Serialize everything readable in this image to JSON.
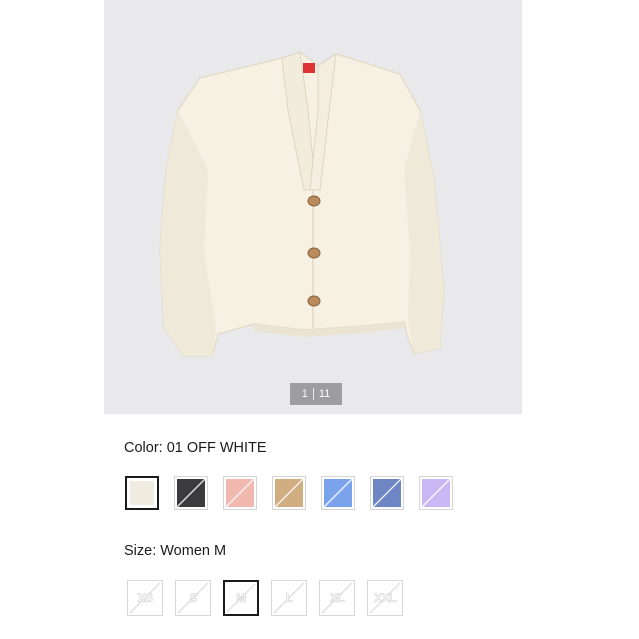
{
  "gallery": {
    "current": "1",
    "total": "11",
    "product_image": "cream-cardigan-photo"
  },
  "color": {
    "label": "Color:",
    "value": "01 OFF WHITE",
    "swatches": [
      {
        "name": "off-white",
        "hex": "#f1ece0",
        "selected": true,
        "slashed": false
      },
      {
        "name": "dark-gray",
        "hex": "#3b3b3d",
        "selected": false,
        "slashed": true
      },
      {
        "name": "pink",
        "hex": "#f0b8ae",
        "selected": false,
        "slashed": true
      },
      {
        "name": "beige",
        "hex": "#d1ad82",
        "selected": false,
        "slashed": true
      },
      {
        "name": "blue",
        "hex": "#7aa3ec",
        "selected": false,
        "slashed": true
      },
      {
        "name": "navy-blue",
        "hex": "#6f86c4",
        "selected": false,
        "slashed": true
      },
      {
        "name": "lavender",
        "hex": "#c9b8f3",
        "selected": false,
        "slashed": true
      }
    ]
  },
  "size": {
    "label": "Size:",
    "value": "Women M",
    "options": [
      {
        "label": "XS",
        "selected": false,
        "unavailable": true
      },
      {
        "label": "S",
        "selected": false,
        "unavailable": true
      },
      {
        "label": "M",
        "selected": true,
        "unavailable": true
      },
      {
        "label": "L",
        "selected": false,
        "unavailable": true
      },
      {
        "label": "XL",
        "selected": false,
        "unavailable": true
      },
      {
        "label": "XXL",
        "selected": false,
        "unavailable": true
      }
    ]
  }
}
